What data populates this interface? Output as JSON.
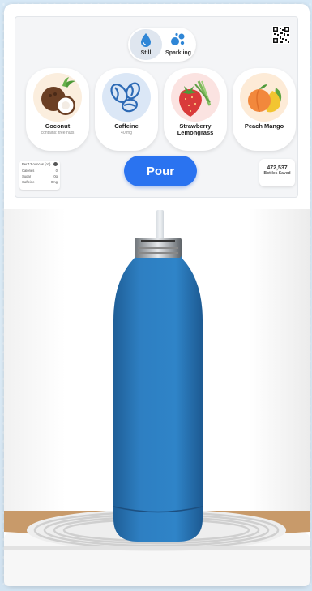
{
  "water_type": {
    "options": [
      {
        "label": "Still",
        "icon": "water-drop-icon",
        "selected": true
      },
      {
        "label": "Sparkling",
        "icon": "bubbles-icon",
        "selected": false
      }
    ]
  },
  "qr": {
    "caption": ""
  },
  "flavors": [
    {
      "name": "Coconut",
      "subtitle": "contains: tree nuts",
      "icon": "coconut-icon"
    },
    {
      "name": "Caffeine",
      "subtitle": "40 mg",
      "icon": "coffee-beans-icon"
    },
    {
      "name": "Strawberry Lemongrass",
      "subtitle": "",
      "icon": "strawberry-icon"
    },
    {
      "name": "Peach Mango",
      "subtitle": "",
      "icon": "peach-icon"
    }
  ],
  "nutrition": {
    "header": "Per 12 ounces (oz)",
    "rows": [
      {
        "label": "Calories",
        "value": "0"
      },
      {
        "label": "Sugar",
        "value": "0g"
      },
      {
        "label": "Caffeine",
        "value": "0mg"
      }
    ]
  },
  "pour_button": {
    "label": "Pour"
  },
  "bottles_saved": {
    "count": "472,537",
    "label": "Bottles Saved"
  },
  "colors": {
    "accent": "#2a73f0",
    "bottle": "#2e7fc2",
    "background": "#d6e8f6"
  }
}
